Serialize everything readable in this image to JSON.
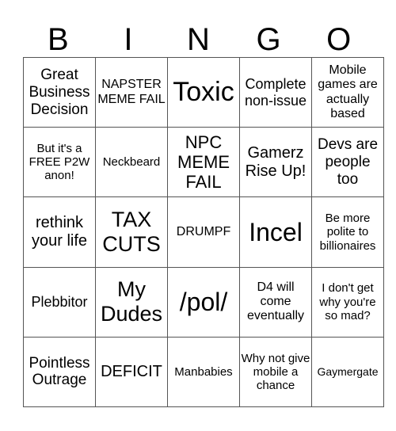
{
  "header": [
    "B",
    "I",
    "N",
    "G",
    "O"
  ],
  "cells": [
    [
      "Great Business Decision",
      "NAPSTER MEME FAIL",
      "Toxic",
      "Complete non-issue",
      "Mobile games are actually based"
    ],
    [
      "But it's a FREE P2W anon!",
      "Neckbeard",
      "NPC MEME FAIL",
      "Gamerz Rise Up!",
      "Devs are people too"
    ],
    [
      "rethink your life",
      "TAX CUTS",
      "DRUMPF",
      "Incel",
      "Be more polite to billionaires"
    ],
    [
      "Plebbitor",
      "My Dudes",
      "/pol/",
      "D4 will come eventually",
      "I don't get why you're so mad?"
    ],
    [
      "Pointless Outrage",
      "DEFICIT",
      "Manbabies",
      "Why not give mobile a chance",
      "Gaymergate"
    ]
  ]
}
